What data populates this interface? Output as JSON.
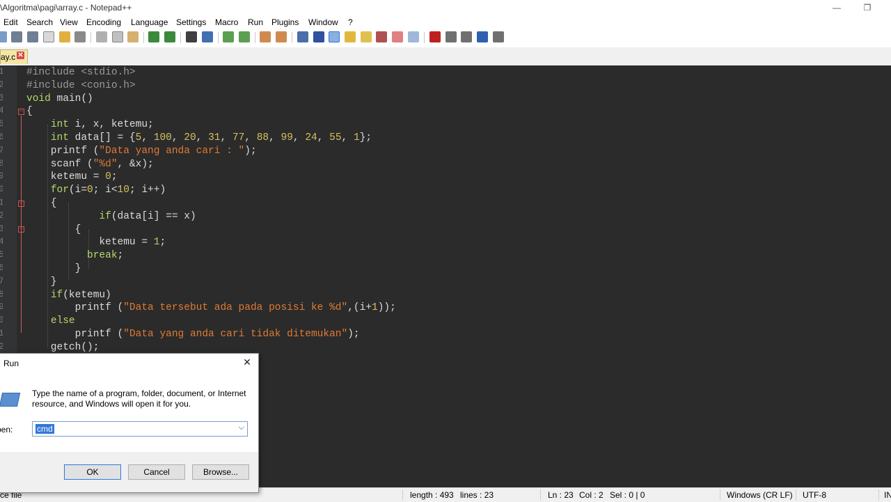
{
  "window": {
    "title": "\\Algoritma\\pagi\\array.c - Notepad++",
    "minimize_glyph": "—",
    "restore_glyph": "❐"
  },
  "menu": [
    "Edit",
    "Search",
    "View",
    "Encoding",
    "Language",
    "Settings",
    "Macro",
    "Run",
    "Plugins",
    "Window",
    "?"
  ],
  "tab": {
    "label": "ay.c",
    "close_glyph": "✕"
  },
  "editor": {
    "line_numbers": [
      "1",
      "2",
      "3",
      "4",
      "5",
      "6",
      "7",
      "8",
      "9",
      "0",
      "1",
      "2",
      "3",
      "4",
      "5",
      "6",
      "7",
      "8",
      "9",
      "0",
      "1",
      "2"
    ],
    "lines": [
      [
        [
          "pp",
          "#include <stdio.h>"
        ]
      ],
      [
        [
          "pp",
          "#include <conio.h>"
        ]
      ],
      [
        [
          "kw",
          "void"
        ],
        [
          "id",
          " main()"
        ]
      ],
      [
        [
          "id",
          "{"
        ]
      ],
      [
        [
          "id",
          "    "
        ],
        [
          "kw",
          "int"
        ],
        [
          "id",
          " i, x, ketemu;"
        ]
      ],
      [
        [
          "id",
          "    "
        ],
        [
          "kw",
          "int"
        ],
        [
          "id",
          " data[] = {"
        ],
        [
          "num",
          "5"
        ],
        [
          "id",
          ", "
        ],
        [
          "num",
          "100"
        ],
        [
          "id",
          ", "
        ],
        [
          "num",
          "20"
        ],
        [
          "id",
          ", "
        ],
        [
          "num",
          "31"
        ],
        [
          "id",
          ", "
        ],
        [
          "num",
          "77"
        ],
        [
          "id",
          ", "
        ],
        [
          "num",
          "88"
        ],
        [
          "id",
          ", "
        ],
        [
          "num",
          "99"
        ],
        [
          "id",
          ", "
        ],
        [
          "num",
          "24"
        ],
        [
          "id",
          ", "
        ],
        [
          "num",
          "55"
        ],
        [
          "id",
          ", "
        ],
        [
          "num",
          "1"
        ],
        [
          "id",
          "};"
        ]
      ],
      [
        [
          "id",
          "    printf ("
        ],
        [
          "str",
          "\"Data yang anda cari : \""
        ],
        [
          "id",
          ");"
        ]
      ],
      [
        [
          "id",
          "    scanf ("
        ],
        [
          "str",
          "\"%d\""
        ],
        [
          "id",
          ", &x);"
        ]
      ],
      [
        [
          "id",
          "    ketemu = "
        ],
        [
          "num",
          "0"
        ],
        [
          "id",
          ";"
        ]
      ],
      [
        [
          "id",
          "    "
        ],
        [
          "kw",
          "for"
        ],
        [
          "id",
          "(i="
        ],
        [
          "num",
          "0"
        ],
        [
          "id",
          "; i<"
        ],
        [
          "num",
          "10"
        ],
        [
          "id",
          "; i++)"
        ]
      ],
      [
        [
          "id",
          "    {"
        ]
      ],
      [
        [
          "id",
          "            "
        ],
        [
          "kw",
          "if"
        ],
        [
          "id",
          "(data[i] == x)"
        ]
      ],
      [
        [
          "id",
          "        {"
        ]
      ],
      [
        [
          "id",
          "            ketemu = "
        ],
        [
          "num",
          "1"
        ],
        [
          "id",
          ";"
        ]
      ],
      [
        [
          "id",
          "          "
        ],
        [
          "kw",
          "break"
        ],
        [
          "id",
          ";"
        ]
      ],
      [
        [
          "id",
          "        }"
        ]
      ],
      [
        [
          "id",
          "    }"
        ]
      ],
      [
        [
          "id",
          "    "
        ],
        [
          "kw",
          "if"
        ],
        [
          "id",
          "(ketemu)"
        ]
      ],
      [
        [
          "id",
          "        printf ("
        ],
        [
          "str",
          "\"Data tersebut ada pada posisi ke %d\""
        ],
        [
          "id",
          ",(i+"
        ],
        [
          "num",
          "1"
        ],
        [
          "id",
          "));"
        ]
      ],
      [
        [
          "id",
          "    "
        ],
        [
          "kw",
          "else"
        ]
      ],
      [
        [
          "id",
          "        printf ("
        ],
        [
          "str",
          "\"Data yang anda cari tidak ditemukan\""
        ],
        [
          "id",
          ");"
        ]
      ],
      [
        [
          "id",
          "    getch();"
        ]
      ]
    ]
  },
  "status": {
    "left": "ce file",
    "length": "length : 493",
    "lines": "lines : 23",
    "ln": "Ln : 23",
    "col": "Col : 2",
    "sel": "Sel : 0 | 0",
    "eol": "Windows (CR LF)",
    "encoding": "UTF-8",
    "ins": "IN"
  },
  "run_dialog": {
    "title": "Run",
    "close_glyph": "✕",
    "description": "Type the name of a program, folder, document, or Internet resource, and Windows will open it for you.",
    "open_label": "pen:",
    "open_value": "cmd",
    "dropdown_glyph": "⌵",
    "ok_label": "OK",
    "cancel_label": "Cancel",
    "browse_label": "Browse..."
  }
}
